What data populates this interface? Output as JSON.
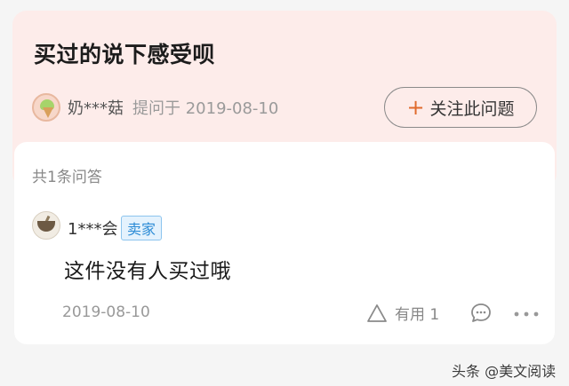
{
  "question": {
    "title": "买过的说下感受呗",
    "asker_name": "奶***菇",
    "asked_label": "提问于 2019-08-10",
    "follow_button": "关注此问题"
  },
  "answers": {
    "count_label": "共1条问答",
    "items": [
      {
        "author": "1***会",
        "badge": "卖家",
        "text": "这件没有人买过哦",
        "date": "2019-08-10",
        "useful_label": "有用 1"
      }
    ]
  },
  "watermark": "头条 @美文阅读",
  "colors": {
    "header_bg": "#fdecea",
    "accent_orange": "#e06a2c",
    "badge_blue": "#2d8cd6"
  },
  "icons": [
    "ice-cream-avatar-icon",
    "plus-icon",
    "mortar-avatar-icon",
    "thumb-triangle-icon",
    "comment-icon",
    "more-icon"
  ]
}
